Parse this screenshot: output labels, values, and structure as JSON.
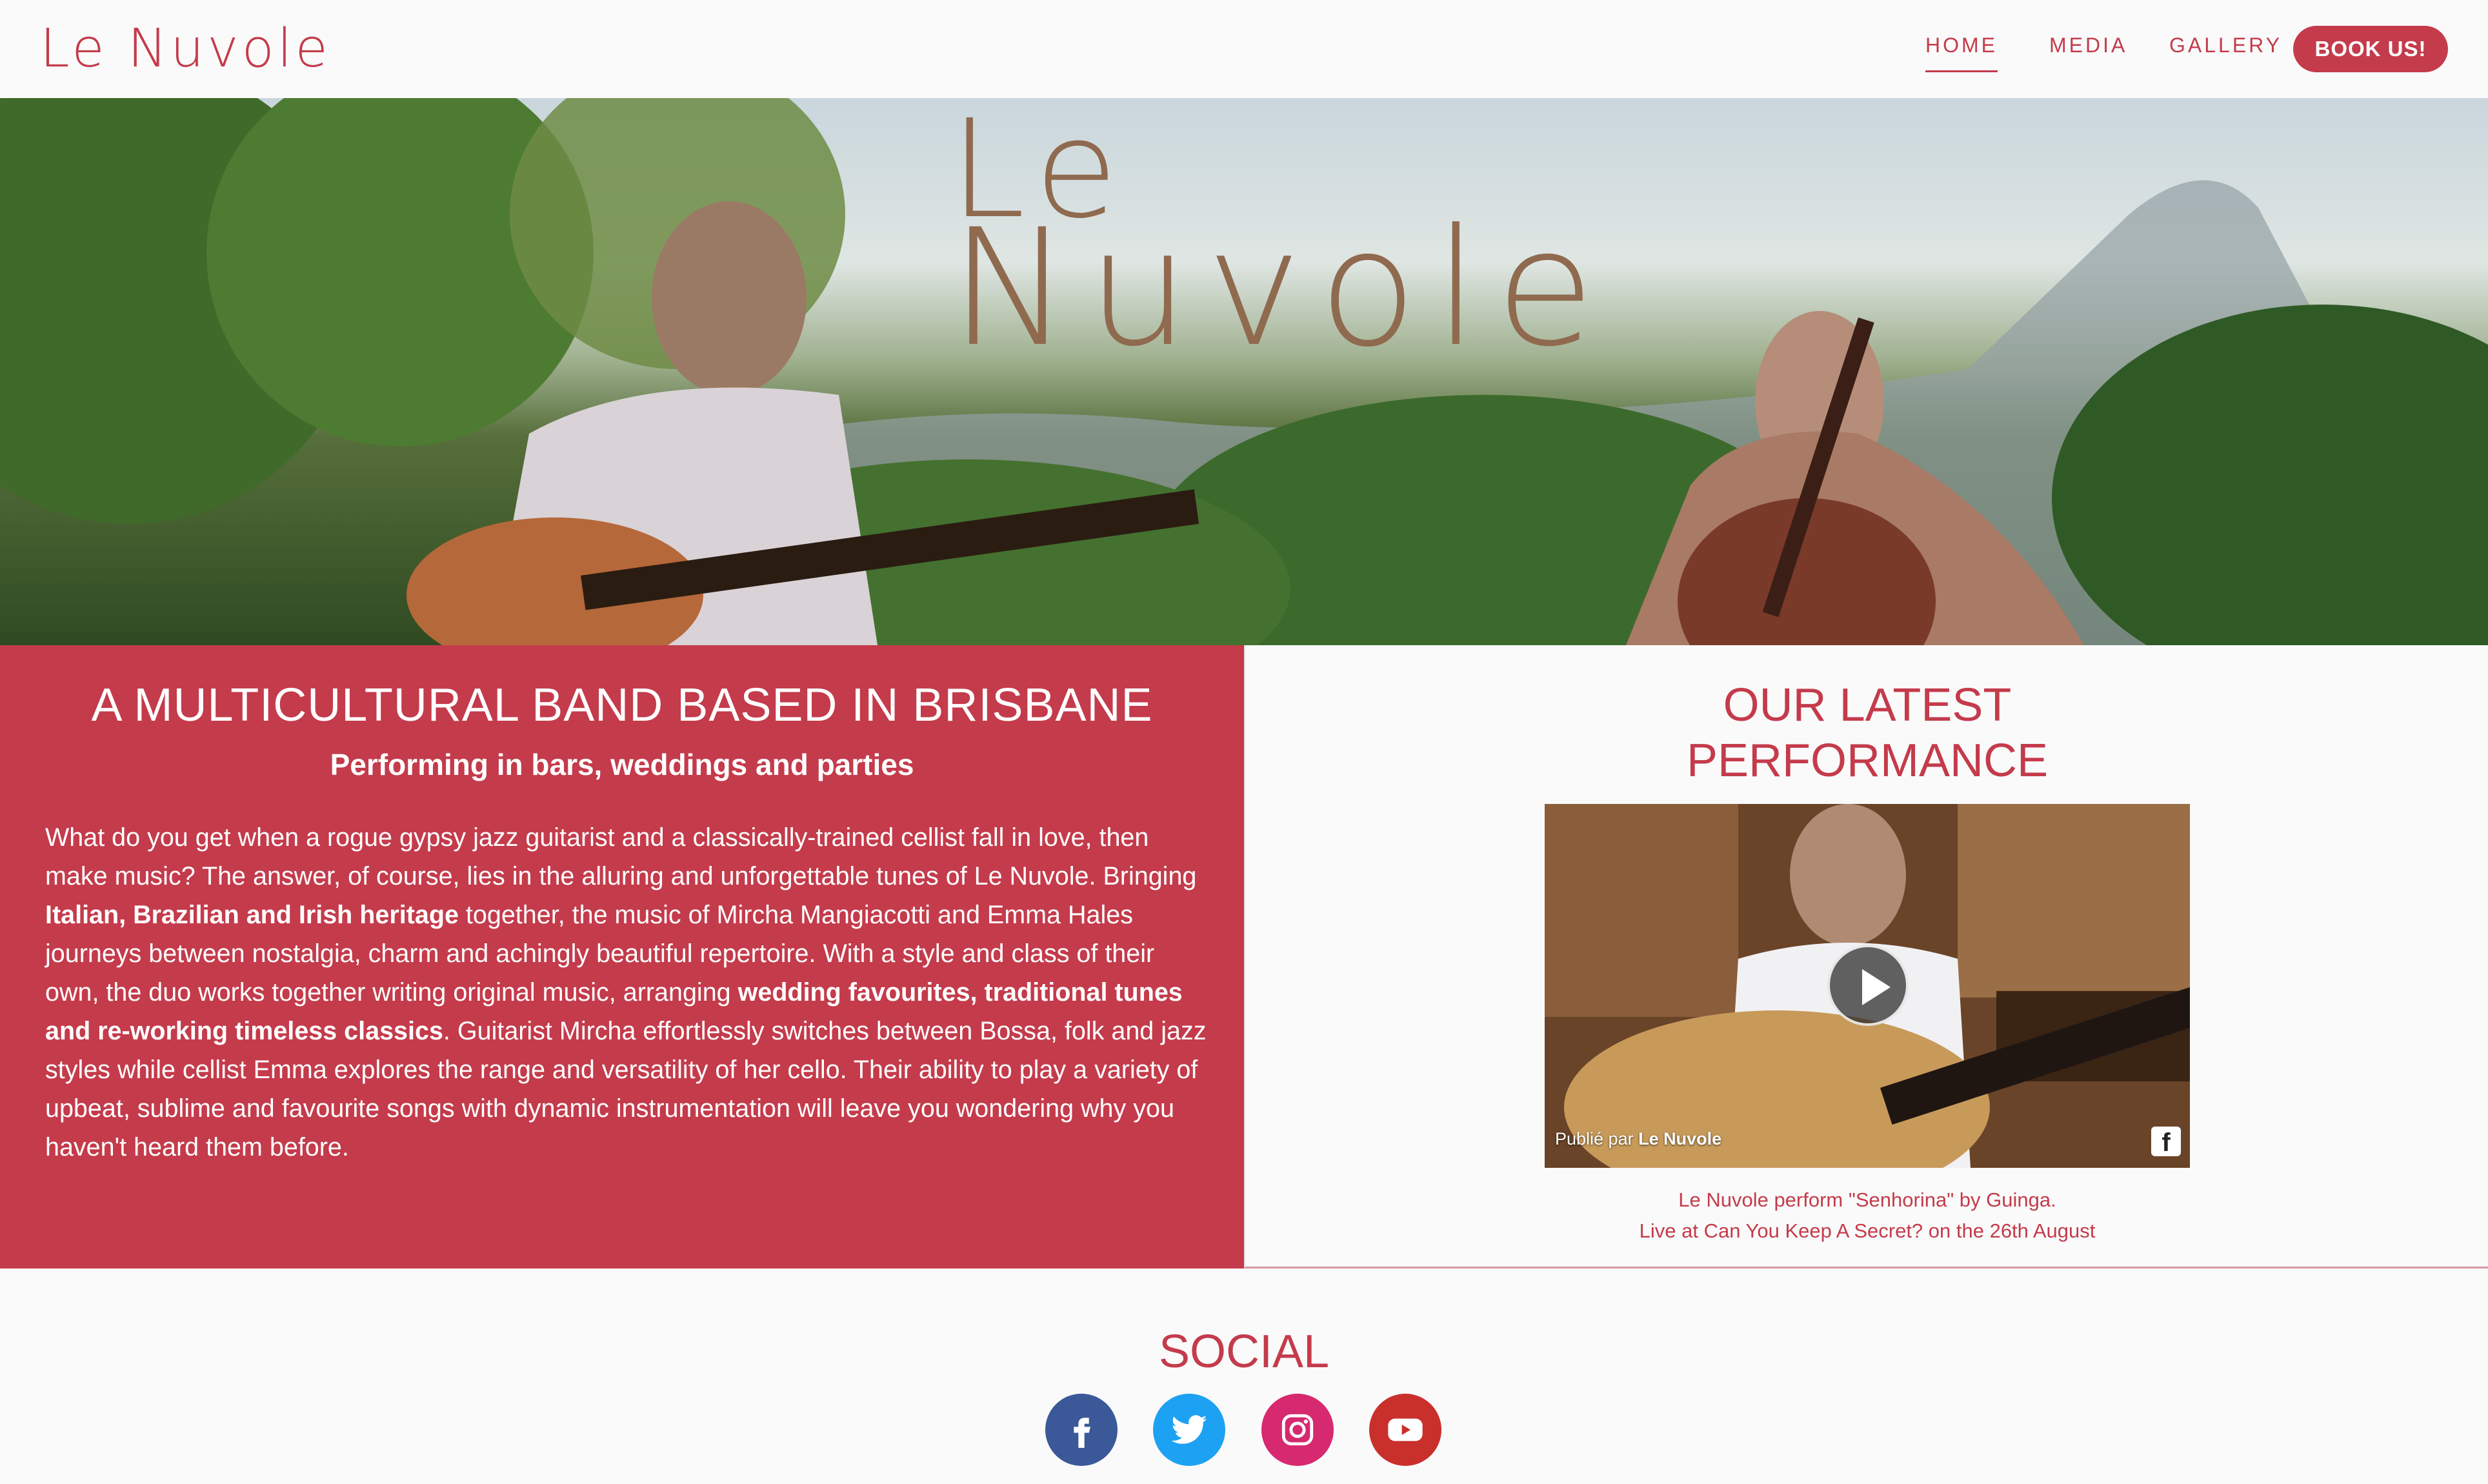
{
  "nav": {
    "brand": "Le Nuvole",
    "links": [
      "HOME",
      "MEDIA",
      "GALLERY"
    ],
    "active": "HOME",
    "cta": "BOOK US!"
  },
  "hero": {
    "logo_line1": "Le",
    "logo_line2": "Nuvole"
  },
  "about": {
    "title": "A MULTICULTURAL BAND BASED IN BRISBANE",
    "subtitle": "Performing in bars, weddings and parties",
    "body": [
      "What do you get when a rogue gypsy jazz guitarist and a classically-trained cellist fall in love, then make music? The answer, of course, lies in the alluring and unforgettable tunes of Le Nuvole. Bringing ",
      "Italian, Brazilian and Irish heritage",
      " together, the music of Mircha Mangiacotti and Emma Hales journeys between nostalgia, charm and achingly beautiful repertoire. With a style and class of their own, the duo works together writing original music, arranging ",
      "wedding favourites, traditional tunes and re-working timeless classics",
      ". Guitarist Mircha effortlessly switches between Bossa, folk and jazz styles while cellist Emma explores the range and versatility of her cello. Their ability to play a variety of upbeat, sublime and favourite songs with dynamic instrumentation will leave you wondering why you haven't heard them before."
    ]
  },
  "performance": {
    "title_line1": "OUR LATEST",
    "title_line2": "PERFORMANCE",
    "video_credit_prefix": "Publié par ",
    "video_credit_name": "Le Nuvole",
    "caption_line1": "Le Nuvole perform \"Senhorina\" by Guinga.",
    "caption_line2": "Live at Can You Keep A Secret? on the 26th August"
  },
  "social": {
    "title": "SOCIAL",
    "icons": [
      "facebook-icon",
      "twitter-icon",
      "instagram-icon",
      "youtube-icon"
    ]
  },
  "colors": {
    "accent": "#c43b4b",
    "facebook": "#3b5998",
    "twitter": "#1da1f2",
    "instagram": "#d6296f",
    "youtube": "#c9302c"
  }
}
